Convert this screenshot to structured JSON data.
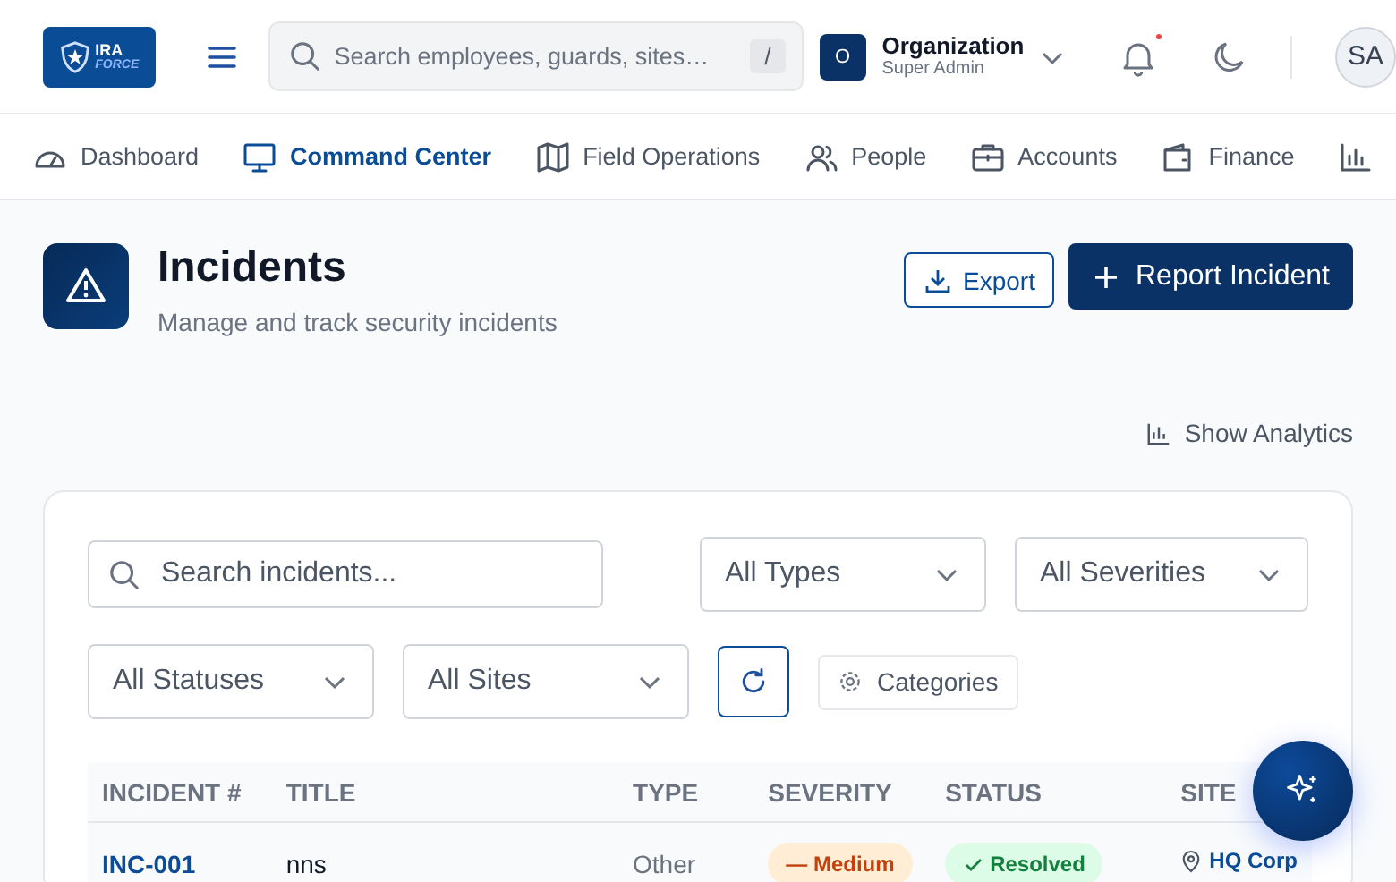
{
  "header": {
    "logo": {
      "line1": "IRA",
      "line2": "FORCE"
    },
    "search": {
      "placeholder": "Search employees, guards, sites…",
      "shortcut": "/"
    },
    "organization": {
      "initial": "O",
      "name": "Organization",
      "role": "Super Admin"
    },
    "notifications": {
      "unread": true
    },
    "avatar": "SA"
  },
  "nav": [
    {
      "label": "Dashboard",
      "selected": false
    },
    {
      "label": "Command Center",
      "selected": true
    },
    {
      "label": "Field Operations",
      "selected": false
    },
    {
      "label": "People",
      "selected": false
    },
    {
      "label": "Accounts",
      "selected": false
    },
    {
      "label": "Finance",
      "selected": false
    }
  ],
  "page": {
    "title": "Incidents",
    "subtitle": "Manage and track security incidents",
    "buttons": {
      "export": "Export",
      "report": "Report Incident"
    },
    "analytics_link": "Show Analytics"
  },
  "filters": {
    "search_placeholder": "Search incidents...",
    "selects": [
      "All Types",
      "All Severities",
      "All Statuses",
      "All Sites"
    ],
    "categories": "Categories"
  },
  "table": {
    "columns": [
      "INCIDENT #",
      "TITLE",
      "TYPE",
      "SEVERITY",
      "STATUS",
      "SITE"
    ],
    "rows": [
      {
        "id": "INC-001",
        "title": "nns",
        "type": "Other",
        "severity": {
          "label": "— Medium",
          "kind": "medium"
        },
        "status": {
          "label": "Resolved",
          "kind": "resolved"
        },
        "site": "HQ Corp"
      }
    ]
  }
}
